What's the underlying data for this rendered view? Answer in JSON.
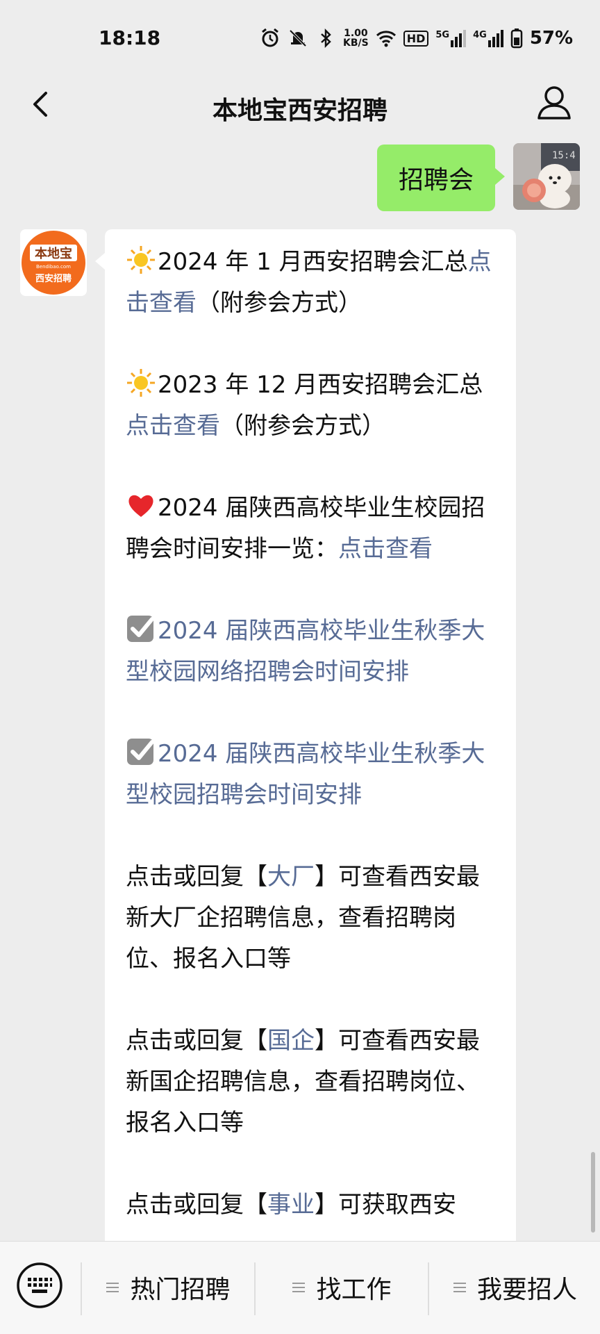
{
  "status_bar": {
    "time": "18:18",
    "net_speed_value": "1.00",
    "net_speed_unit": "KB/S",
    "hd_badge": "HD",
    "signal1_label": "5G",
    "signal2_label": "4G",
    "battery": "57%"
  },
  "header": {
    "title": "本地宝西安招聘"
  },
  "chat": {
    "outgoing_message": "招聘会",
    "bot_avatar": {
      "top_text": "本地宝",
      "mid_text": "Bendibao.com",
      "bottom_text": "西安招聘"
    },
    "incoming": {
      "p1": {
        "text": "2024 年 1 月西安招聘会汇总",
        "link": "点击查看",
        "suffix": "（附参会方式）"
      },
      "p2": {
        "text": "2023 年 12 月西安招聘会汇总",
        "link": "点击查看",
        "suffix": "（附参会方式）"
      },
      "p3": {
        "text": "2024 届陕西高校毕业生校园招聘会时间安排一览：",
        "link": "点击查看"
      },
      "p4": {
        "link": "2024 届陕西高校毕业生秋季大型校园网络招聘会时间安排"
      },
      "p5": {
        "link": "2024 届陕西高校毕业生秋季大型校园招聘会时间安排"
      },
      "p6": {
        "pre": "点击或回复【",
        "link": "大厂",
        "post": "】可查看西安最新大厂企招聘信息，查看招聘岗位、报名入口等"
      },
      "p7": {
        "pre": "点击或回复【",
        "link": "国企",
        "post": "】可查看西安最新国企招聘信息，查看招聘岗位、报名入口等"
      },
      "p8": {
        "pre": "点击或回复【",
        "link": "事业",
        "post": "】可获取西安"
      }
    }
  },
  "bottom_menu": {
    "item1": "热门招聘",
    "item2": "找工作",
    "item3": "我要招人"
  },
  "colors": {
    "outgoing_bubble": "#95ec69",
    "link": "#576b95",
    "background": "#ededed",
    "brand_orange": "#f26b1d"
  }
}
